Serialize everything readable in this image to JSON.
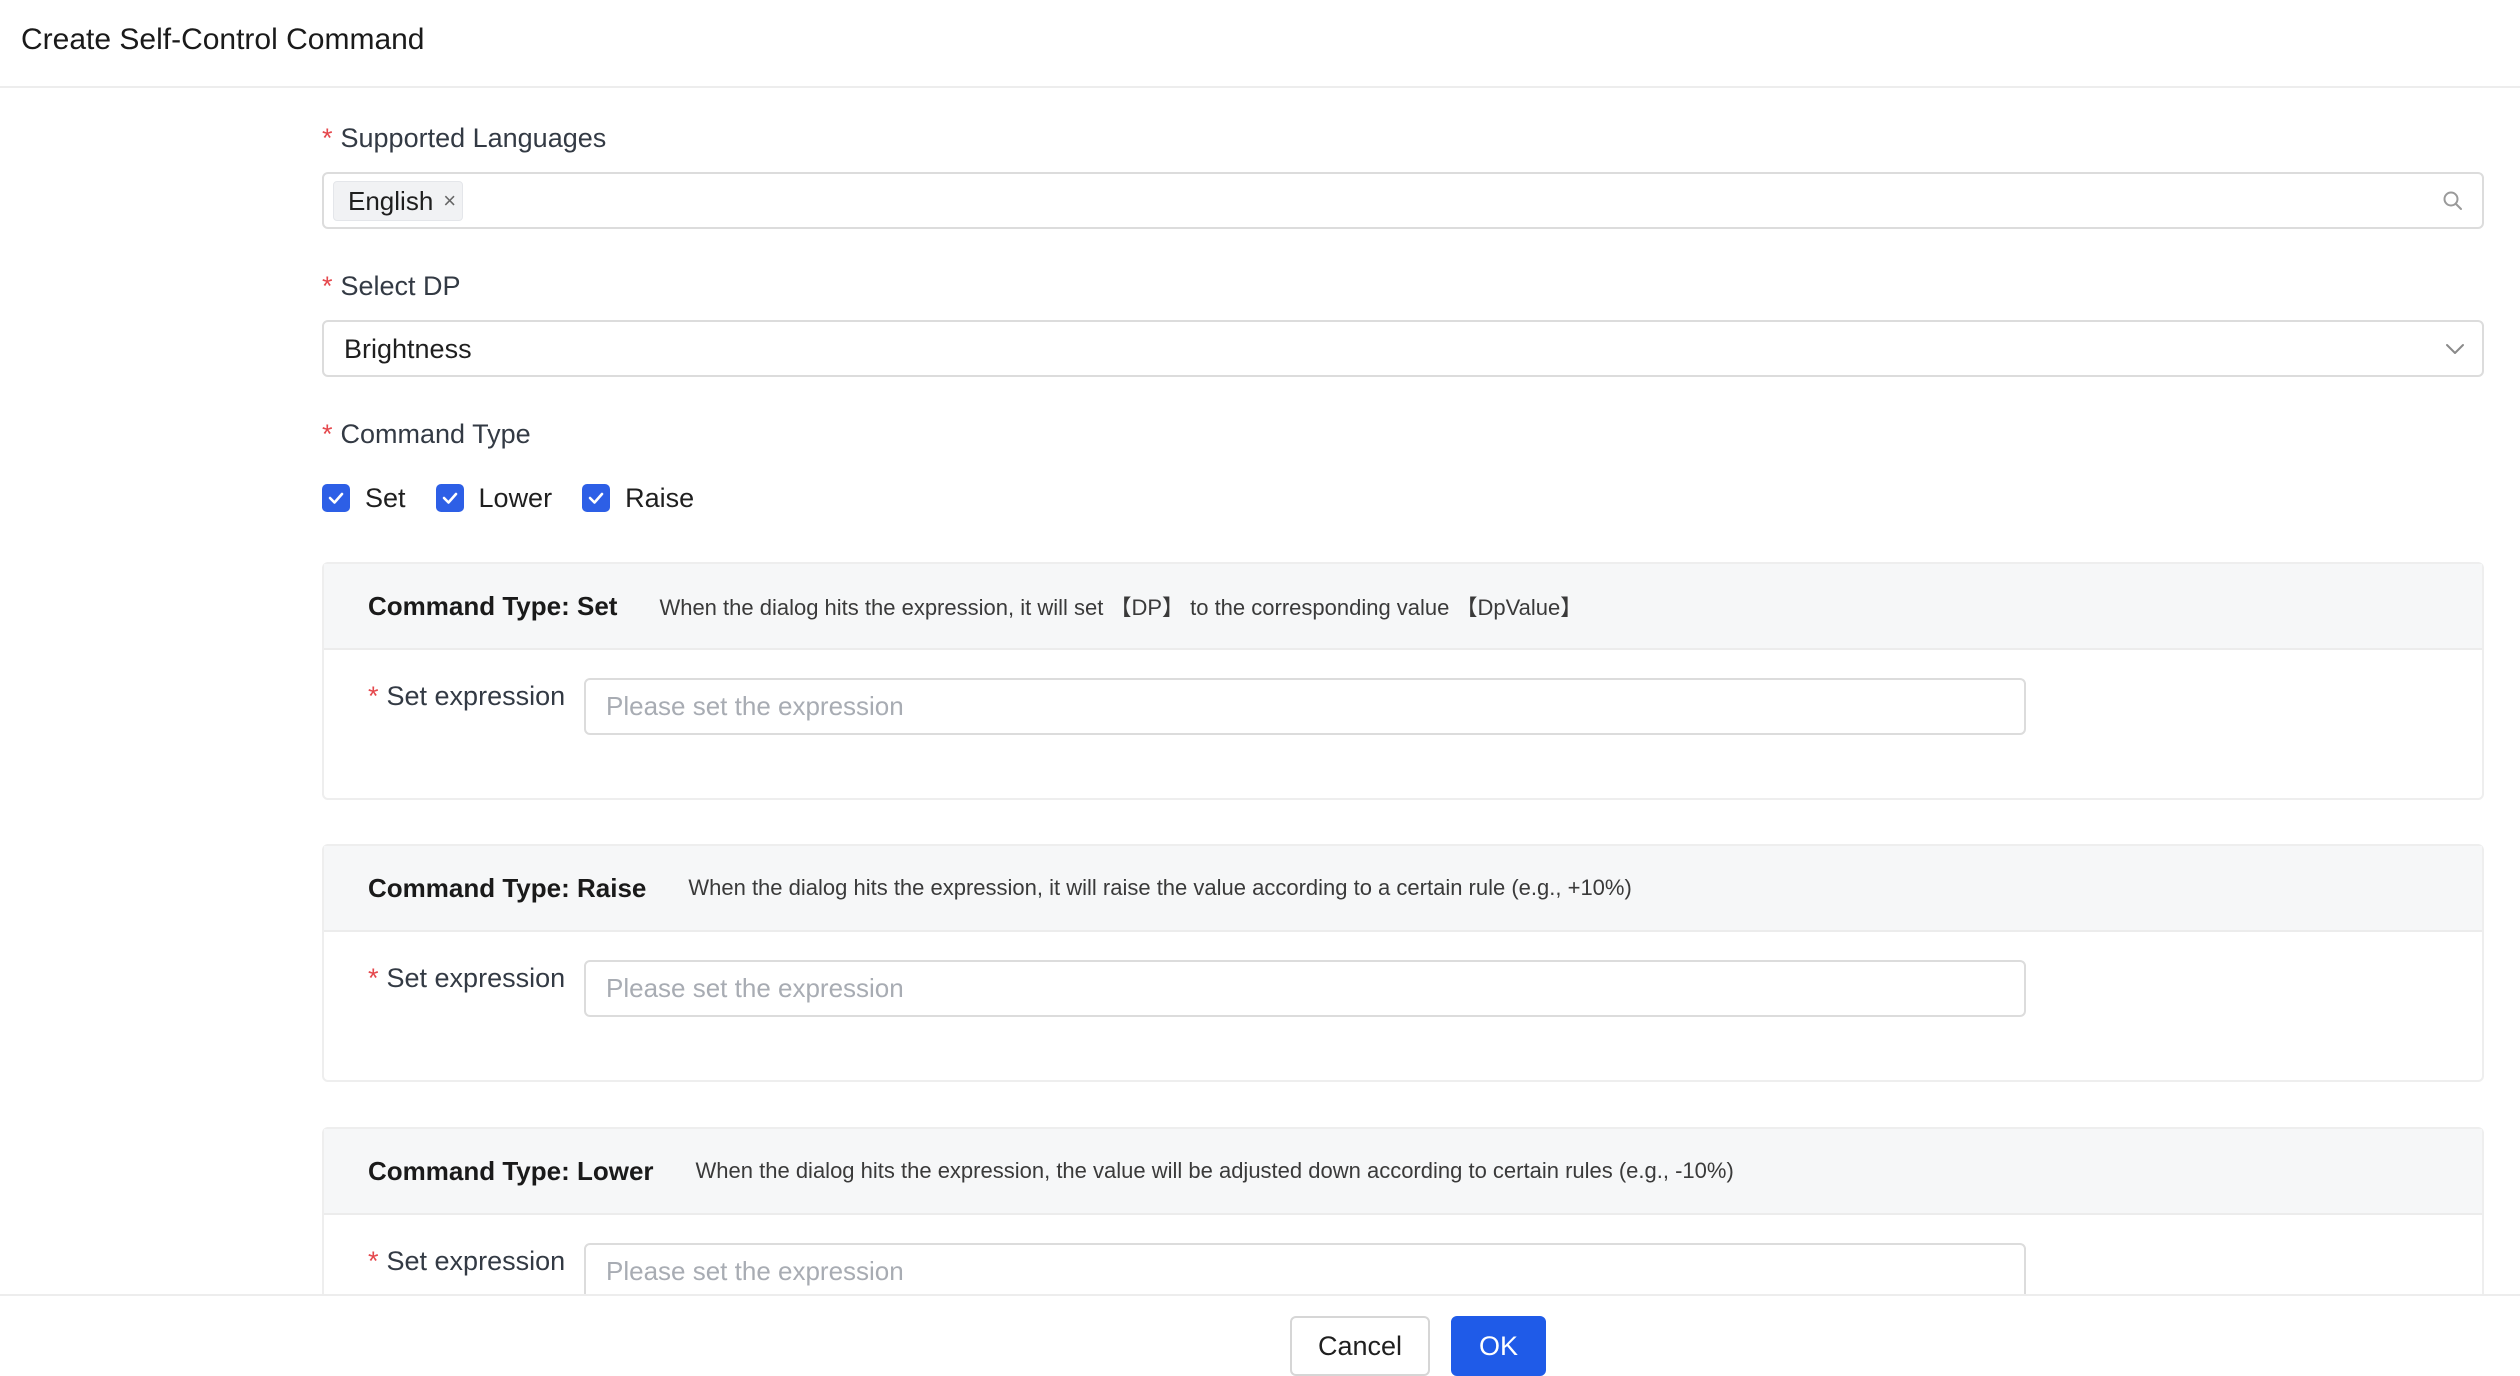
{
  "dialog": {
    "title": "Create Self-Control Command"
  },
  "form": {
    "required_mark": "*",
    "languages": {
      "label": "Supported Languages",
      "tags": [
        {
          "label": "English",
          "remove_glyph": "×"
        }
      ],
      "icon": "search-icon"
    },
    "dp": {
      "label": "Select DP",
      "value": "Brightness",
      "icon": "chevron-down-icon"
    },
    "command_type": {
      "label": "Command Type",
      "options": [
        {
          "label": "Set",
          "checked": true
        },
        {
          "label": "Lower",
          "checked": true
        },
        {
          "label": "Raise",
          "checked": true
        }
      ]
    },
    "cards": [
      {
        "title": "Command Type: Set",
        "description": "When the dialog hits the expression, it will set 【DP】 to the corresponding value 【DpValue】",
        "expression_label": "Set expression",
        "expression_placeholder": "Please set the expression",
        "expression_value": ""
      },
      {
        "title": "Command Type: Raise",
        "description": "When the dialog hits the expression, it will raise the value according to a certain rule (e.g., +10%)",
        "expression_label": "Set expression",
        "expression_placeholder": "Please set the expression",
        "expression_value": ""
      },
      {
        "title": "Command Type: Lower",
        "description": "When the dialog hits the expression, the value will be adjusted down according to certain rules (e.g., -10%)",
        "expression_label": "Set expression",
        "expression_placeholder": "Please set the expression",
        "expression_value": ""
      }
    ]
  },
  "footer": {
    "cancel_label": "Cancel",
    "ok_label": "OK"
  },
  "colors": {
    "primary": "#1f5be8",
    "checkbox": "#2d5fe6",
    "required": "#e5484d",
    "card_header_bg": "#f6f7f8"
  }
}
